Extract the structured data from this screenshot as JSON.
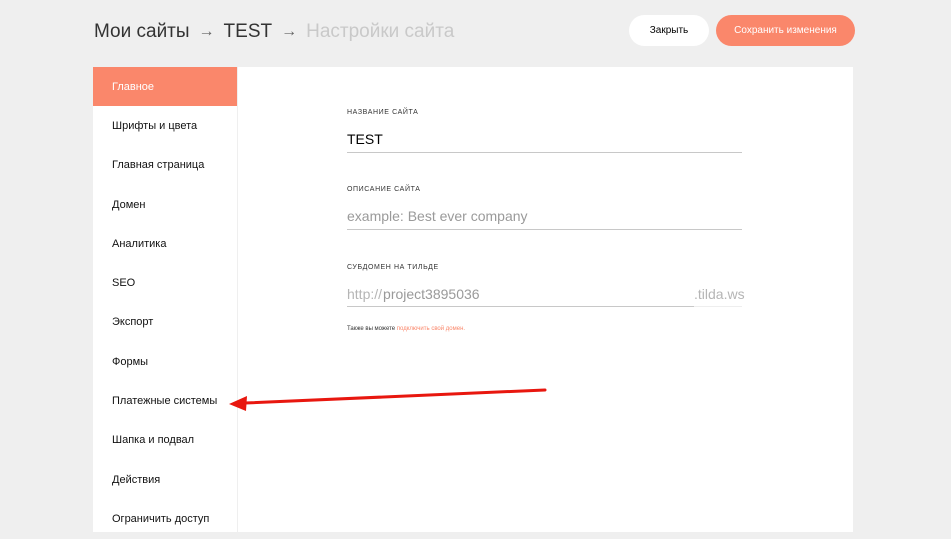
{
  "header": {
    "breadcrumb": {
      "root": "Мои сайты",
      "separator": "→",
      "site": "TEST",
      "current": "Настройки сайта"
    },
    "close_label": "Закрыть",
    "save_label": "Сохранить изменения"
  },
  "sidebar": {
    "items": [
      {
        "label": "Главное",
        "active": true
      },
      {
        "label": "Шрифты и цвета"
      },
      {
        "label": "Главная страница"
      },
      {
        "label": "Домен"
      },
      {
        "label": "Аналитика"
      },
      {
        "label": "SEO"
      },
      {
        "label": "Экспорт"
      },
      {
        "label": "Формы"
      },
      {
        "label": "Платежные системы"
      },
      {
        "label": "Шапка и подвал"
      },
      {
        "label": "Действия"
      },
      {
        "label": "Ограничить доступ"
      }
    ]
  },
  "form": {
    "site_name": {
      "label": "НАЗВАНИЕ САЙТА",
      "value": "TEST"
    },
    "site_description": {
      "label": "ОПИСАНИЕ САЙТА",
      "placeholder": "example: Best ever company"
    },
    "subdomain": {
      "label": "СУБДОМЕН НА ТИЛЬДЕ",
      "prefix": "http://",
      "value": "project3895036",
      "suffix": ".tilda.ws"
    },
    "hint": {
      "text": "Также вы можете ",
      "link": "подключить свой домен."
    }
  },
  "colors": {
    "accent": "#fa876b",
    "annotation_arrow": "#e8170f",
    "background": "#efefef"
  }
}
